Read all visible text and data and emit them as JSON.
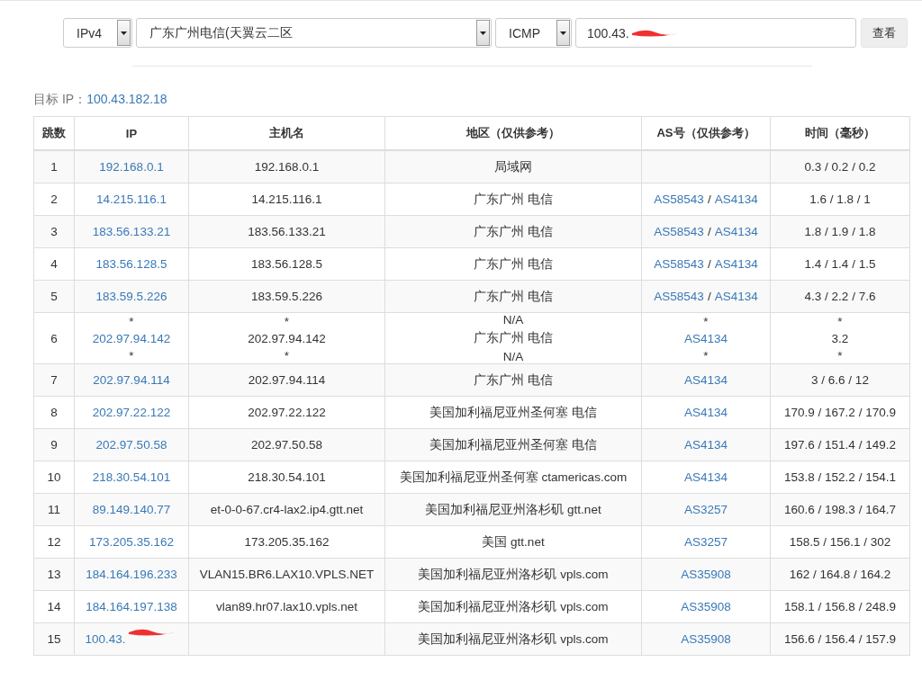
{
  "query": {
    "protocol_version": "IPv4",
    "node": "广东广州电信(天翼云二区",
    "method": "ICMP",
    "target": "100.43.",
    "button": "查看"
  },
  "target_ip": {
    "label": "目标 IP：",
    "value": "100.43.182.18"
  },
  "table": {
    "columns": [
      "跳数",
      "IP",
      "主机名",
      "地区（仅供参考）",
      "AS号（仅供参考）",
      "时间（毫秒）"
    ],
    "rows": [
      {
        "hop": "1",
        "ip": [
          "192.168.0.1"
        ],
        "host": [
          "192.168.0.1"
        ],
        "region": [
          "局域网"
        ],
        "time": [
          "0.3 / 0.2 / 0.2"
        ]
      },
      {
        "hop": "2",
        "ip": [
          "14.215.116.1"
        ],
        "host": [
          "14.215.116.1"
        ],
        "region": [
          "广东广州 电信"
        ],
        "as": [
          [
            "AS58543",
            "/",
            "AS4134"
          ]
        ],
        "time": [
          "1.6 / 1.8 / 1"
        ]
      },
      {
        "hop": "3",
        "ip": [
          "183.56.133.21"
        ],
        "host": [
          "183.56.133.21"
        ],
        "region": [
          "广东广州 电信"
        ],
        "as": [
          [
            "AS58543",
            "/",
            "AS4134"
          ]
        ],
        "time": [
          "1.8 / 1.9 / 1.8"
        ]
      },
      {
        "hop": "4",
        "ip": [
          "183.56.128.5"
        ],
        "host": [
          "183.56.128.5"
        ],
        "region": [
          "广东广州 电信"
        ],
        "as": [
          [
            "AS58543",
            "/",
            "AS4134"
          ]
        ],
        "time": [
          "1.4 / 1.4 / 1.5"
        ]
      },
      {
        "hop": "5",
        "ip": [
          "183.59.5.226"
        ],
        "host": [
          "183.59.5.226"
        ],
        "region": [
          "广东广州 电信"
        ],
        "as": [
          [
            "AS58543",
            "/",
            "AS4134"
          ]
        ],
        "time": [
          "4.3 / 2.2 / 7.6"
        ]
      },
      {
        "hop": "6",
        "ip": [
          "*",
          "202.97.94.142",
          "*"
        ],
        "host": [
          "*",
          "202.97.94.142",
          "*"
        ],
        "region": [
          "N/A",
          "广东广州 电信",
          "N/A"
        ],
        "as": [
          [
            "*"
          ],
          [
            "AS4134"
          ],
          [
            "*"
          ]
        ],
        "time": [
          "*",
          "3.2",
          "*"
        ]
      },
      {
        "hop": "7",
        "ip": [
          "202.97.94.114"
        ],
        "host": [
          "202.97.94.114"
        ],
        "region": [
          "广东广州 电信"
        ],
        "as": [
          [
            "AS4134"
          ]
        ],
        "time": [
          "3 / 6.6 / 12"
        ]
      },
      {
        "hop": "8",
        "ip": [
          "202.97.22.122"
        ],
        "host": [
          "202.97.22.122"
        ],
        "region": [
          "美国加利福尼亚州圣何塞 电信"
        ],
        "as": [
          [
            "AS4134"
          ]
        ],
        "time": [
          "170.9 / 167.2 / 170.9"
        ]
      },
      {
        "hop": "9",
        "ip": [
          "202.97.50.58"
        ],
        "host": [
          "202.97.50.58"
        ],
        "region": [
          "美国加利福尼亚州圣何塞 电信"
        ],
        "as": [
          [
            "AS4134"
          ]
        ],
        "time": [
          "197.6 / 151.4 / 149.2"
        ]
      },
      {
        "hop": "10",
        "ip": [
          "218.30.54.101"
        ],
        "host": [
          "218.30.54.101"
        ],
        "region": [
          "美国加利福尼亚州圣何塞 ctamericas.com"
        ],
        "as": [
          [
            "AS4134"
          ]
        ],
        "time": [
          "153.8 / 152.2 / 154.1"
        ]
      },
      {
        "hop": "11",
        "ip": [
          "89.149.140.77"
        ],
        "host": [
          "et-0-0-67.cr4-lax2.ip4.gtt.net"
        ],
        "region": [
          "美国加利福尼亚州洛杉矶 gtt.net"
        ],
        "as": [
          [
            "AS3257"
          ]
        ],
        "time": [
          "160.6 / 198.3 / 164.7"
        ]
      },
      {
        "hop": "12",
        "ip": [
          "173.205.35.162"
        ],
        "host": [
          "173.205.35.162"
        ],
        "region": [
          "美国 gtt.net"
        ],
        "as": [
          [
            "AS3257"
          ]
        ],
        "time": [
          "158.5 / 156.1 / 302"
        ]
      },
      {
        "hop": "13",
        "ip": [
          "184.164.196.233"
        ],
        "host": [
          "VLAN15.BR6.LAX10.VPLS.NET"
        ],
        "region": [
          "美国加利福尼亚州洛杉矶 vpls.com"
        ],
        "as": [
          [
            "AS35908"
          ]
        ],
        "time": [
          "162 / 164.8 / 164.2"
        ]
      },
      {
        "hop": "14",
        "ip": [
          "184.164.197.138"
        ],
        "host": [
          "vlan89.hr07.lax10.vpls.net"
        ],
        "region": [
          "美国加利福尼亚州洛杉矶 vpls.com"
        ],
        "as": [
          [
            "AS35908"
          ]
        ],
        "time": [
          "158.1 / 156.8 / 248.9"
        ]
      },
      {
        "hop": "15",
        "ip": [
          "100.43."
        ],
        "host": [],
        "region": [
          "美国加利福尼亚州洛杉矶 vpls.com"
        ],
        "as": [
          [
            "AS35908"
          ]
        ],
        "time": [
          "156.6 / 156.4 / 157.9"
        ]
      }
    ]
  }
}
